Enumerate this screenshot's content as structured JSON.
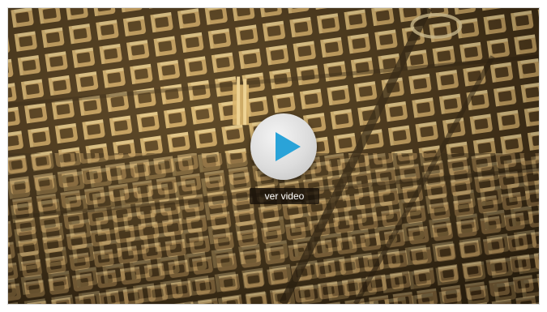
{
  "video": {
    "thumbnail_description": "aerial-city-grid",
    "play_icon": "play-icon",
    "label": "ver video",
    "accent_color": "#2aa3d8"
  }
}
